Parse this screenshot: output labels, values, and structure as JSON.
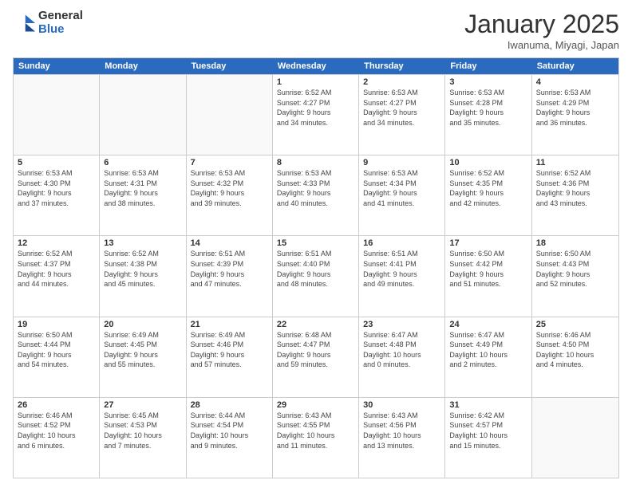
{
  "logo": {
    "general": "General",
    "blue": "Blue"
  },
  "title": {
    "month": "January 2025",
    "location": "Iwanuma, Miyagi, Japan"
  },
  "header": {
    "days": [
      "Sunday",
      "Monday",
      "Tuesday",
      "Wednesday",
      "Thursday",
      "Friday",
      "Saturday"
    ]
  },
  "weeks": [
    {
      "cells": [
        {
          "day": "",
          "info": "",
          "empty": true
        },
        {
          "day": "",
          "info": "",
          "empty": true
        },
        {
          "day": "",
          "info": "",
          "empty": true
        },
        {
          "day": "1",
          "info": "Sunrise: 6:52 AM\nSunset: 4:27 PM\nDaylight: 9 hours\nand 34 minutes."
        },
        {
          "day": "2",
          "info": "Sunrise: 6:53 AM\nSunset: 4:27 PM\nDaylight: 9 hours\nand 34 minutes."
        },
        {
          "day": "3",
          "info": "Sunrise: 6:53 AM\nSunset: 4:28 PM\nDaylight: 9 hours\nand 35 minutes."
        },
        {
          "day": "4",
          "info": "Sunrise: 6:53 AM\nSunset: 4:29 PM\nDaylight: 9 hours\nand 36 minutes."
        }
      ]
    },
    {
      "cells": [
        {
          "day": "5",
          "info": "Sunrise: 6:53 AM\nSunset: 4:30 PM\nDaylight: 9 hours\nand 37 minutes."
        },
        {
          "day": "6",
          "info": "Sunrise: 6:53 AM\nSunset: 4:31 PM\nDaylight: 9 hours\nand 38 minutes."
        },
        {
          "day": "7",
          "info": "Sunrise: 6:53 AM\nSunset: 4:32 PM\nDaylight: 9 hours\nand 39 minutes."
        },
        {
          "day": "8",
          "info": "Sunrise: 6:53 AM\nSunset: 4:33 PM\nDaylight: 9 hours\nand 40 minutes."
        },
        {
          "day": "9",
          "info": "Sunrise: 6:53 AM\nSunset: 4:34 PM\nDaylight: 9 hours\nand 41 minutes."
        },
        {
          "day": "10",
          "info": "Sunrise: 6:52 AM\nSunset: 4:35 PM\nDaylight: 9 hours\nand 42 minutes."
        },
        {
          "day": "11",
          "info": "Sunrise: 6:52 AM\nSunset: 4:36 PM\nDaylight: 9 hours\nand 43 minutes."
        }
      ]
    },
    {
      "cells": [
        {
          "day": "12",
          "info": "Sunrise: 6:52 AM\nSunset: 4:37 PM\nDaylight: 9 hours\nand 44 minutes."
        },
        {
          "day": "13",
          "info": "Sunrise: 6:52 AM\nSunset: 4:38 PM\nDaylight: 9 hours\nand 45 minutes."
        },
        {
          "day": "14",
          "info": "Sunrise: 6:51 AM\nSunset: 4:39 PM\nDaylight: 9 hours\nand 47 minutes."
        },
        {
          "day": "15",
          "info": "Sunrise: 6:51 AM\nSunset: 4:40 PM\nDaylight: 9 hours\nand 48 minutes."
        },
        {
          "day": "16",
          "info": "Sunrise: 6:51 AM\nSunset: 4:41 PM\nDaylight: 9 hours\nand 49 minutes."
        },
        {
          "day": "17",
          "info": "Sunrise: 6:50 AM\nSunset: 4:42 PM\nDaylight: 9 hours\nand 51 minutes."
        },
        {
          "day": "18",
          "info": "Sunrise: 6:50 AM\nSunset: 4:43 PM\nDaylight: 9 hours\nand 52 minutes."
        }
      ]
    },
    {
      "cells": [
        {
          "day": "19",
          "info": "Sunrise: 6:50 AM\nSunset: 4:44 PM\nDaylight: 9 hours\nand 54 minutes."
        },
        {
          "day": "20",
          "info": "Sunrise: 6:49 AM\nSunset: 4:45 PM\nDaylight: 9 hours\nand 55 minutes."
        },
        {
          "day": "21",
          "info": "Sunrise: 6:49 AM\nSunset: 4:46 PM\nDaylight: 9 hours\nand 57 minutes."
        },
        {
          "day": "22",
          "info": "Sunrise: 6:48 AM\nSunset: 4:47 PM\nDaylight: 9 hours\nand 59 minutes."
        },
        {
          "day": "23",
          "info": "Sunrise: 6:47 AM\nSunset: 4:48 PM\nDaylight: 10 hours\nand 0 minutes."
        },
        {
          "day": "24",
          "info": "Sunrise: 6:47 AM\nSunset: 4:49 PM\nDaylight: 10 hours\nand 2 minutes."
        },
        {
          "day": "25",
          "info": "Sunrise: 6:46 AM\nSunset: 4:50 PM\nDaylight: 10 hours\nand 4 minutes."
        }
      ]
    },
    {
      "cells": [
        {
          "day": "26",
          "info": "Sunrise: 6:46 AM\nSunset: 4:52 PM\nDaylight: 10 hours\nand 6 minutes."
        },
        {
          "day": "27",
          "info": "Sunrise: 6:45 AM\nSunset: 4:53 PM\nDaylight: 10 hours\nand 7 minutes."
        },
        {
          "day": "28",
          "info": "Sunrise: 6:44 AM\nSunset: 4:54 PM\nDaylight: 10 hours\nand 9 minutes."
        },
        {
          "day": "29",
          "info": "Sunrise: 6:43 AM\nSunset: 4:55 PM\nDaylight: 10 hours\nand 11 minutes."
        },
        {
          "day": "30",
          "info": "Sunrise: 6:43 AM\nSunset: 4:56 PM\nDaylight: 10 hours\nand 13 minutes."
        },
        {
          "day": "31",
          "info": "Sunrise: 6:42 AM\nSunset: 4:57 PM\nDaylight: 10 hours\nand 15 minutes."
        },
        {
          "day": "",
          "info": "",
          "empty": true
        }
      ]
    }
  ]
}
